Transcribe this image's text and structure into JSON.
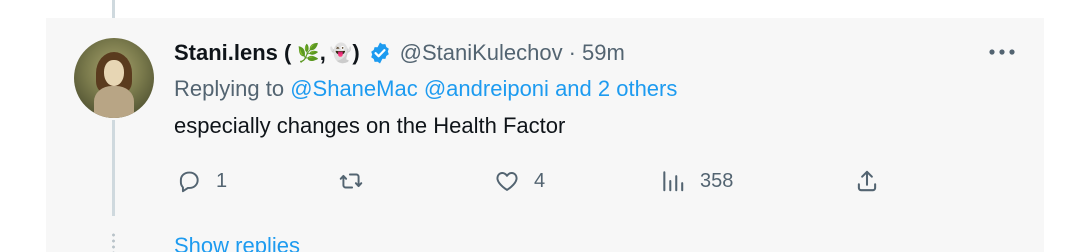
{
  "tweet": {
    "display_name": "Stani.lens (",
    "emoji_1": "🌿",
    "comma": ",",
    "emoji_2": "👻",
    "name_close": ")",
    "handle": "@StaniKulechov",
    "separator": "·",
    "time": "59m",
    "replying_prefix": "Replying to",
    "reply_targets": {
      "user_1": "@ShaneMac",
      "user_2": "@andreiponi",
      "others": "and 2 others"
    },
    "text": "especially changes on the Health Factor"
  },
  "actions": {
    "reply_count": "1",
    "retweet_count": "",
    "like_count": "4",
    "views_count": "358"
  },
  "thread": {
    "show_replies_label": "Show replies"
  },
  "icons": {
    "verified": "verified-badge-icon",
    "more": "more-horizontal-icon",
    "reply": "reply-bubble-icon",
    "retweet": "retweet-icon",
    "like": "heart-icon",
    "views": "views-bar-chart-icon",
    "share": "share-upload-icon"
  },
  "colors": {
    "accent": "#1d9bf0",
    "muted": "#536471",
    "text": "#0f1419",
    "card_background": "#f7f7f7"
  }
}
